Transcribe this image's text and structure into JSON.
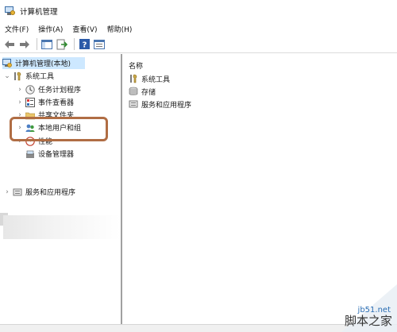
{
  "window": {
    "title": "计算机管理"
  },
  "menu": [
    "文件(F)",
    "操作(A)",
    "查看(V)",
    "帮助(H)"
  ],
  "toolbar": {
    "buttons": [
      "back-icon",
      "forward-icon",
      "show-hide-tree-icon",
      "export-list-icon",
      "help-icon",
      "properties-icon"
    ]
  },
  "tree": {
    "root": "计算机管理(本地)",
    "system_tools": "系统工具",
    "task_scheduler": "任务计划程序",
    "event_viewer": "事件查看器",
    "shared_folders": "共享文件夹",
    "local_users": "本地用户和组",
    "performance": "性能",
    "device_manager": "设备管理器",
    "services": "服务和应用程序"
  },
  "list": {
    "header": "名称",
    "items": [
      "系统工具",
      "存储",
      "服务和应用程序"
    ]
  },
  "watermark": {
    "url": "jb51.net",
    "text": "脚本之家"
  },
  "colors": {
    "highlight": "#b06d44",
    "selected": "#cde8ff"
  }
}
